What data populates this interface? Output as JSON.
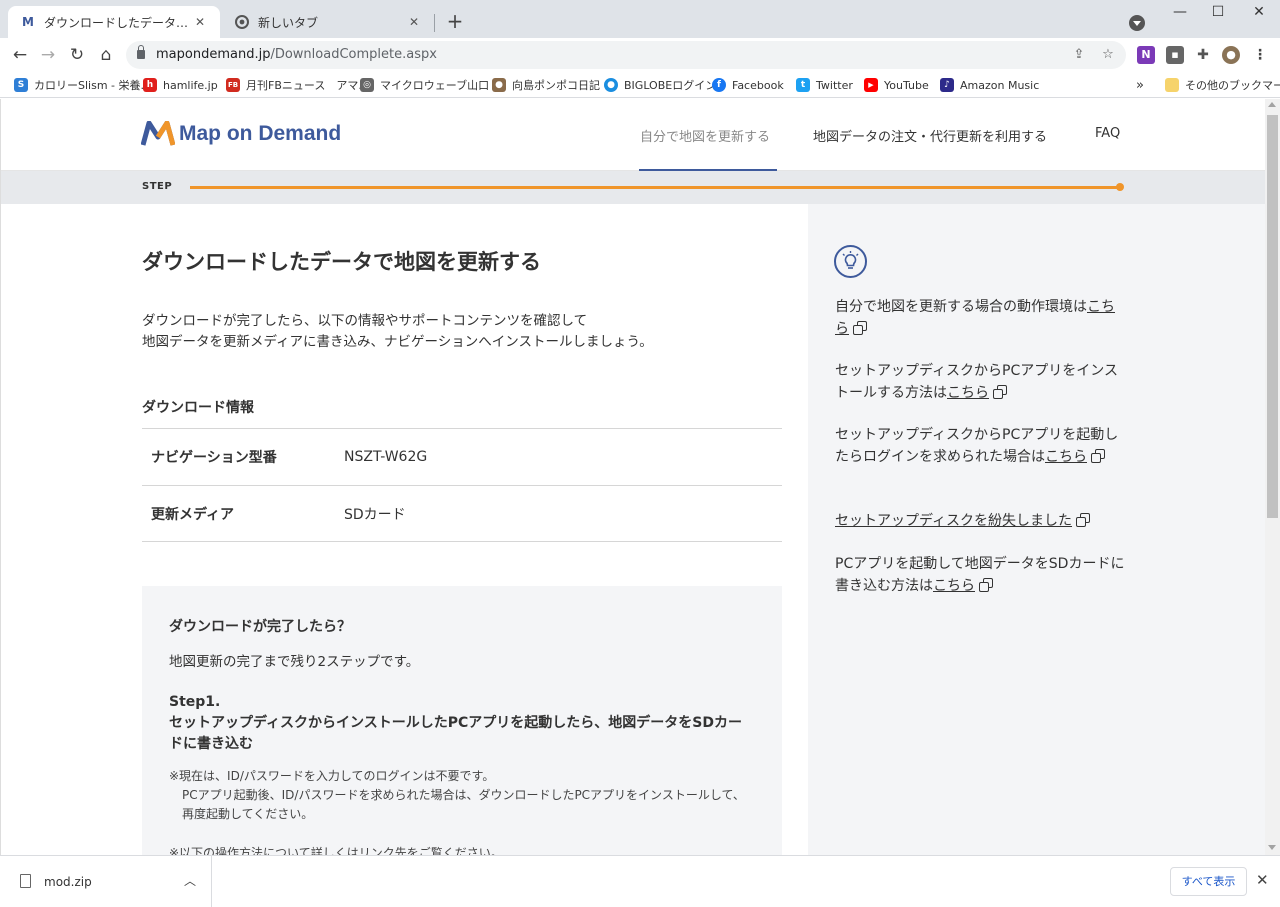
{
  "browser": {
    "tabs": [
      {
        "title": "ダウンロードしたデータで地図を更新す",
        "favicon": "M",
        "close": "✕"
      },
      {
        "title": "新しいタブ",
        "close": "✕"
      }
    ],
    "new_tab": "+",
    "window_controls": {
      "minimize": "—",
      "maximize": "☐",
      "close": "✕"
    },
    "address": {
      "host": "mapondemand.jp",
      "path": "/DownloadComplete.aspx"
    },
    "bookmarks": [
      {
        "label": "カロリーSlism - 栄養...",
        "icon_color": "#2f7fd6",
        "icon": "S"
      },
      {
        "label": "hamlife.jp",
        "icon_color": "#e0201c",
        "icon": "h"
      },
      {
        "label": "月刊FBニュース　アマ...",
        "icon_color": "#d12b1f",
        "icon": "FB"
      },
      {
        "label": "マイクロウェーブ山口 -...",
        "icon_color": "#666666",
        "icon": "◎"
      },
      {
        "label": "向島ポンポコ日記",
        "icon_color": "#8a6b4a",
        "icon": "●"
      },
      {
        "label": "BIGLOBEログイン",
        "icon_color": "#1b8ee0",
        "icon": "●"
      },
      {
        "label": "Facebook",
        "icon_color": "#1877f2",
        "icon": "f"
      },
      {
        "label": "Twitter",
        "icon_color": "#1da1f2",
        "icon": "t"
      },
      {
        "label": "YouTube",
        "icon_color": "#ff0000",
        "icon": "▶"
      },
      {
        "label": "Amazon Music",
        "icon_color": "#2d2a8a",
        "icon": "♪"
      }
    ],
    "bookmarks_more": "»",
    "other_bookmarks": "その他のブックマーク"
  },
  "site": {
    "logo_text": "Map on Demand",
    "nav": [
      {
        "label": "自分で地図を更新する"
      },
      {
        "label": "地図データの注文・代行更新を利用する"
      },
      {
        "label": "FAQ"
      }
    ],
    "step_label": "STEP",
    "step_progress": 1.0,
    "accent": "#f0952a",
    "brand": "#3e5a9c"
  },
  "main": {
    "title": "ダウンロードしたデータで地図を更新する",
    "intro_line1": "ダウンロードが完了したら、以下の情報やサポートコンテンツを確認して",
    "intro_line2": "地図データを更新メディアに書き込み、ナビゲーションへインストールしましょう。",
    "download_info_title": "ダウンロード情報",
    "info": [
      {
        "key": "ナビゲーション型番",
        "value": "NSZT-W62G"
      },
      {
        "key": "更新メディア",
        "value": "SDカード"
      }
    ],
    "after": {
      "title": "ダウンロードが完了したら？",
      "subtitle": "地図更新の完了まで残り2ステップです。",
      "step1_label": "Step1.",
      "step1_text": "セットアップディスクからインストールしたPCアプリを起動したら、地図データをSDカードに書き込む",
      "note1": "※現在は、ID/パスワードを入力してのログインは不要です。",
      "note1_detail": "PCアプリ起動後、ID/パスワードを求められた場合は、ダウンロードしたPCアプリをインストールして、再度起動してください。",
      "note2": "※以下の操作方法について詳しくはリンク先をご覧ください。"
    }
  },
  "sidebar": {
    "links": [
      {
        "text": "自分で地図を更新する場合の動作環境は",
        "link": "こちら"
      },
      {
        "text": "セットアップディスクからPCアプリをインストールする方法は",
        "link": "こちら"
      },
      {
        "text": "セットアップディスクからPCアプリを起動したらログインを求められた場合は",
        "link": "こちら"
      },
      {
        "text": "",
        "link": "セットアップディスクを紛失しました"
      },
      {
        "text": "PCアプリを起動して地図データをSDカードに書き込む方法は",
        "link": "こちら"
      }
    ]
  },
  "downloads": {
    "file": "mod.zip",
    "show_all": "すべて表示",
    "close": "✕"
  }
}
